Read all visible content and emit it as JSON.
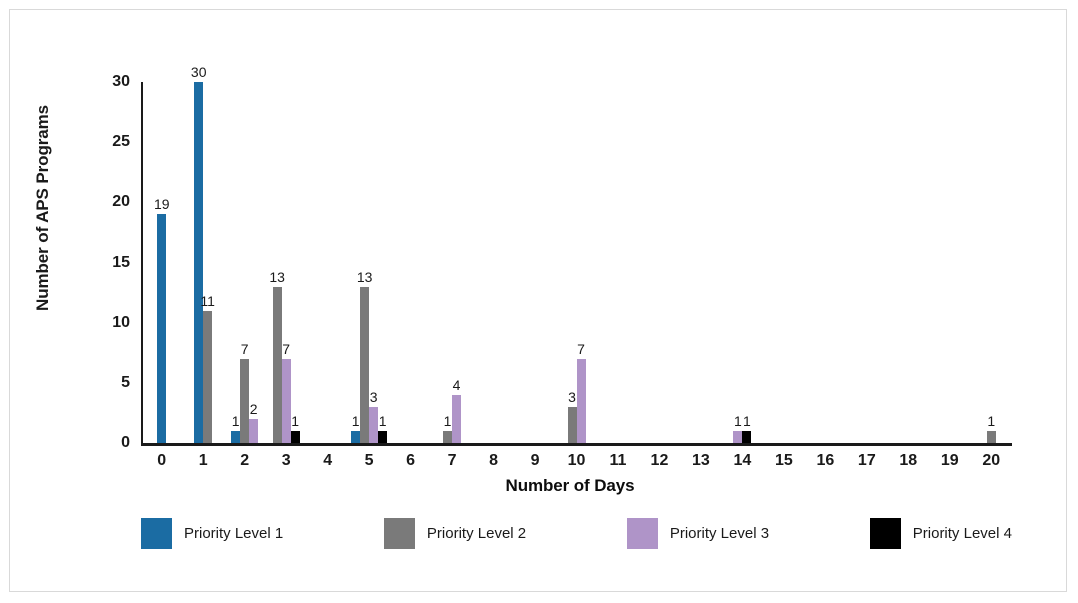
{
  "chart_data": {
    "type": "bar",
    "title": "",
    "xlabel": "Number of Days",
    "ylabel": "Number of APS Programs",
    "categories": [
      "0",
      "1",
      "2",
      "3",
      "4",
      "5",
      "6",
      "7",
      "8",
      "9",
      "10",
      "11",
      "12",
      "13",
      "14",
      "15",
      "16",
      "17",
      "18",
      "19",
      "20"
    ],
    "xlim": [
      0,
      20
    ],
    "ylim": [
      0,
      30
    ],
    "yticks": [
      "0",
      "5",
      "10",
      "15",
      "20",
      "25",
      "30"
    ],
    "ytick_values": [
      0,
      5,
      10,
      15,
      20,
      25,
      30
    ],
    "grid": false,
    "legend_position": "bottom",
    "series": [
      {
        "name": "Priority Level 1",
        "color": "#1B6CA3",
        "values": [
          19,
          30,
          1,
          null,
          null,
          1,
          null,
          null,
          null,
          null,
          null,
          null,
          null,
          null,
          null,
          null,
          null,
          null,
          null,
          null,
          null
        ]
      },
      {
        "name": "Priority Level 2",
        "color": "#7A7A7A",
        "values": [
          null,
          11,
          7,
          13,
          null,
          13,
          null,
          1,
          null,
          null,
          3,
          null,
          null,
          null,
          null,
          null,
          null,
          null,
          null,
          null,
          1
        ]
      },
      {
        "name": "Priority Level 3",
        "color": "#AF94C8",
        "values": [
          null,
          null,
          2,
          7,
          null,
          3,
          null,
          4,
          null,
          null,
          7,
          null,
          null,
          null,
          1,
          null,
          null,
          null,
          null,
          null,
          null
        ]
      },
      {
        "name": "Priority Level 4",
        "color": "#000000",
        "values": [
          null,
          null,
          null,
          1,
          null,
          1,
          null,
          null,
          null,
          null,
          null,
          null,
          null,
          null,
          1,
          null,
          null,
          null,
          null,
          null,
          null
        ]
      }
    ]
  },
  "legend": {
    "items": [
      {
        "label": "Priority Level 1",
        "color": "#1B6CA3",
        "swatch_name": "legend-swatch-priority-level-1"
      },
      {
        "label": "Priority Level 2",
        "color": "#7A7A7A",
        "swatch_name": "legend-swatch-priority-level-2"
      },
      {
        "label": "Priority Level 3",
        "color": "#AF94C8",
        "swatch_name": "legend-swatch-priority-level-3"
      },
      {
        "label": "Priority Level 4",
        "color": "#000000",
        "swatch_name": "legend-swatch-priority-level-4"
      }
    ]
  }
}
